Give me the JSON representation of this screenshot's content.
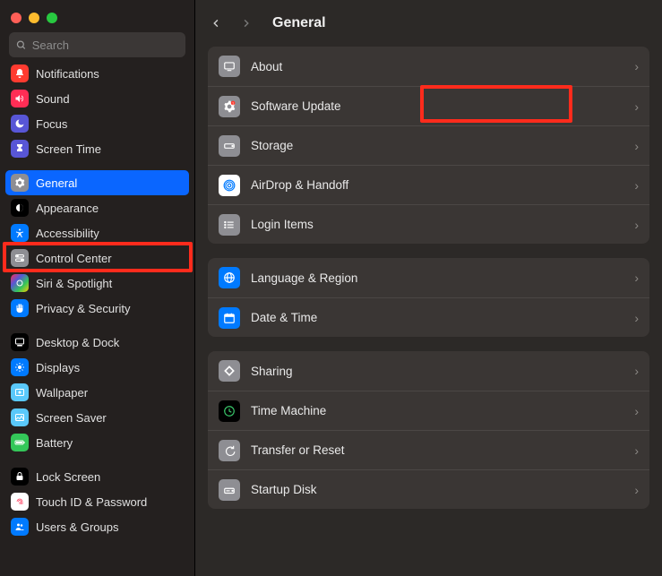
{
  "search": {
    "placeholder": "Search"
  },
  "sidebar": {
    "items": [
      {
        "label": "Notifications",
        "icon": "bell-icon",
        "color": "bg-red"
      },
      {
        "label": "Sound",
        "icon": "speaker-icon",
        "color": "bg-pink"
      },
      {
        "label": "Focus",
        "icon": "moon-icon",
        "color": "bg-purple"
      },
      {
        "label": "Screen Time",
        "icon": "hourglass-icon",
        "color": "bg-purple"
      },
      {
        "label": "General",
        "icon": "gear-icon",
        "color": "bg-gray",
        "selected": true
      },
      {
        "label": "Appearance",
        "icon": "appearance-icon",
        "color": "bg-black"
      },
      {
        "label": "Accessibility",
        "icon": "accessibility-icon",
        "color": "bg-blue"
      },
      {
        "label": "Control Center",
        "icon": "switches-icon",
        "color": "bg-gray"
      },
      {
        "label": "Siri & Spotlight",
        "icon": "siri-icon",
        "color": "bg-siri"
      },
      {
        "label": "Privacy & Security",
        "icon": "hand-icon",
        "color": "bg-blue"
      },
      {
        "label": "Desktop & Dock",
        "icon": "dock-icon",
        "color": "bg-black"
      },
      {
        "label": "Displays",
        "icon": "sun-icon",
        "color": "bg-blue"
      },
      {
        "label": "Wallpaper",
        "icon": "wallpaper-icon",
        "color": "bg-lblue"
      },
      {
        "label": "Screen Saver",
        "icon": "screensaver-icon",
        "color": "bg-lblue"
      },
      {
        "label": "Battery",
        "icon": "battery-icon",
        "color": "bg-green"
      },
      {
        "label": "Lock Screen",
        "icon": "lock-icon",
        "color": "bg-black"
      },
      {
        "label": "Touch ID & Password",
        "icon": "fingerprint-icon",
        "color": "bg-white"
      },
      {
        "label": "Users & Groups",
        "icon": "users-icon",
        "color": "bg-blue"
      }
    ]
  },
  "main": {
    "title": "General",
    "groups": [
      [
        {
          "label": "About",
          "icon": "mac-icon",
          "color": "bg-gray"
        },
        {
          "label": "Software Update",
          "icon": "gear-badge-icon",
          "color": "bg-gray",
          "highlight": true
        },
        {
          "label": "Storage",
          "icon": "disk-icon",
          "color": "bg-gray"
        },
        {
          "label": "AirDrop & Handoff",
          "icon": "airdrop-icon",
          "color": "bg-white"
        },
        {
          "label": "Login Items",
          "icon": "list-icon",
          "color": "bg-gray"
        }
      ],
      [
        {
          "label": "Language & Region",
          "icon": "globe-icon",
          "color": "bg-blue"
        },
        {
          "label": "Date & Time",
          "icon": "calendar-icon",
          "color": "bg-blue"
        }
      ],
      [
        {
          "label": "Sharing",
          "icon": "sharing-icon",
          "color": "bg-gray"
        },
        {
          "label": "Time Machine",
          "icon": "timemachine-icon",
          "color": "bg-black"
        },
        {
          "label": "Transfer or Reset",
          "icon": "transfer-icon",
          "color": "bg-gray"
        },
        {
          "label": "Startup Disk",
          "icon": "startup-icon",
          "color": "bg-gray"
        }
      ]
    ]
  }
}
